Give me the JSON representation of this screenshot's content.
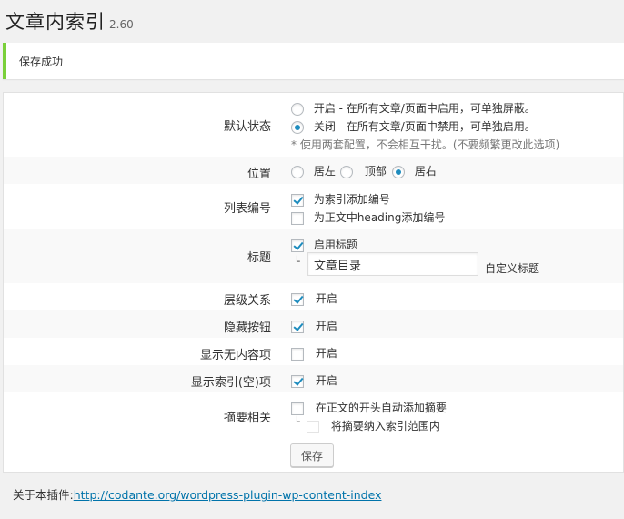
{
  "page": {
    "title": "文章内索引",
    "version": "2.60"
  },
  "notice": {
    "text": "保存成功"
  },
  "settings": {
    "default_state": {
      "label": "默认状态",
      "options": [
        {
          "text": "开启 - 在所有文章/页面中启用，可单独屏蔽。",
          "selected": false
        },
        {
          "text": "关闭 - 在所有文章/页面中禁用，可单独启用。",
          "selected": true
        }
      ],
      "note": "* 使用两套配置，不会相互干扰。(不要频繁更改此选项)"
    },
    "position": {
      "label": "位置",
      "options": [
        {
          "text": "居左",
          "selected": false
        },
        {
          "text": "顶部",
          "selected": false
        },
        {
          "text": "居右",
          "selected": true
        }
      ]
    },
    "list_numbering": {
      "label": "列表编号",
      "options": [
        {
          "text": "为索引添加编号",
          "checked": true
        },
        {
          "text": "为正文中heading添加编号",
          "checked": false
        }
      ]
    },
    "heading": {
      "label": "标题",
      "enable_text": "启用标题",
      "enable_checked": true,
      "value": "文章目录",
      "custom_label": "自定义标题"
    },
    "hierarchy": {
      "label": "层级关系",
      "text": "开启",
      "checked": true
    },
    "hide_button": {
      "label": "隐藏按钮",
      "text": "开启",
      "checked": true
    },
    "show_no_content": {
      "label": "显示无内容项",
      "text": "开启",
      "checked": false
    },
    "show_empty_index": {
      "label": "显示索引(空)项",
      "text": "开启",
      "checked": true
    },
    "excerpt": {
      "label": "摘要相关",
      "auto_add_text": "在正文的开头自动添加摘要",
      "auto_add_checked": false,
      "include_text": "将摘要纳入索引范围内",
      "include_checked": false
    }
  },
  "save_button": "保存",
  "footer": {
    "prefix": "关于本插件:",
    "link_text": "http://codante.org/wordpress-plugin-wp-content-index"
  },
  "colors": {
    "accent": "#1e8cbe",
    "notice_border": "#7ad03a",
    "link": "#0073aa"
  }
}
